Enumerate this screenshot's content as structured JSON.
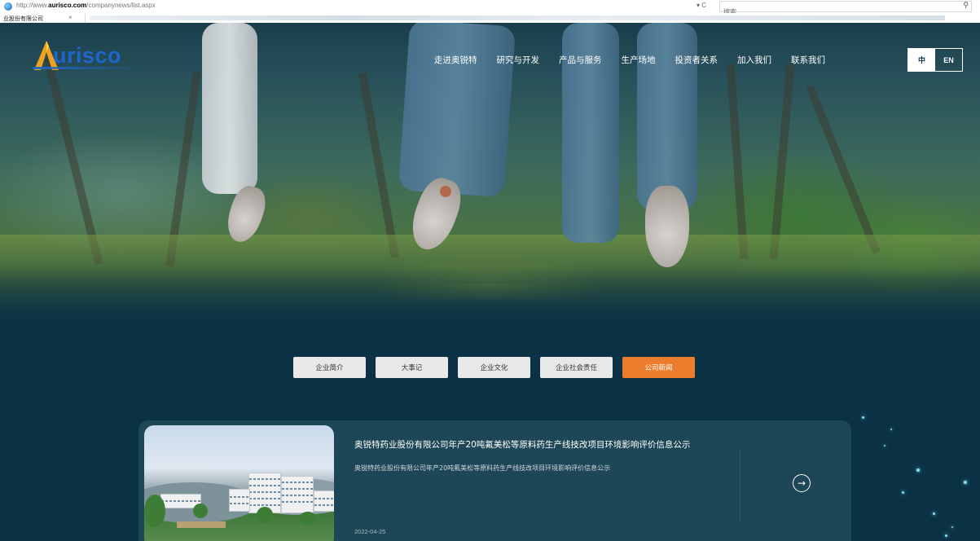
{
  "browser": {
    "url_prefix": "http://www.",
    "url_domain": "aurisco.com",
    "url_path": "/companynews/list.aspx",
    "url_controls": "▾ C",
    "search_placeholder": "搜索...",
    "tab_title": "业股份有限公司",
    "tab_close": "×"
  },
  "header": {
    "logo_text": "urisco",
    "nav": [
      "走进奥锐特",
      "研究与开发",
      "产品与服务",
      "生产场地",
      "投资者关系",
      "加入我们",
      "联系我们"
    ],
    "lang_zh": "中",
    "lang_en": "EN"
  },
  "subtabs": {
    "items": [
      "企业简介",
      "大事记",
      "企业文化",
      "企业社会责任",
      "公司新闻"
    ],
    "active_index": 4
  },
  "news": {
    "title": "奥锐特药业股份有限公司年产20吨氟美松等原料药生产线技改项目环境影响评价信息公示",
    "summary": "奥锐特药业股份有限公司年产20吨氟美松等原料药生产线技改项目环境影响评价信息公示",
    "date": "2022-04-25",
    "arrow": "→"
  },
  "colors": {
    "background": "#0b3244",
    "brand_blue": "#1e66c9",
    "accent_orange": "#ec7d2d",
    "card": "#1d4656"
  },
  "icons": [
    "browser-favicon",
    "search-icon",
    "refresh-icon",
    "tab-close-icon",
    "arrow-right-circle-icon"
  ]
}
